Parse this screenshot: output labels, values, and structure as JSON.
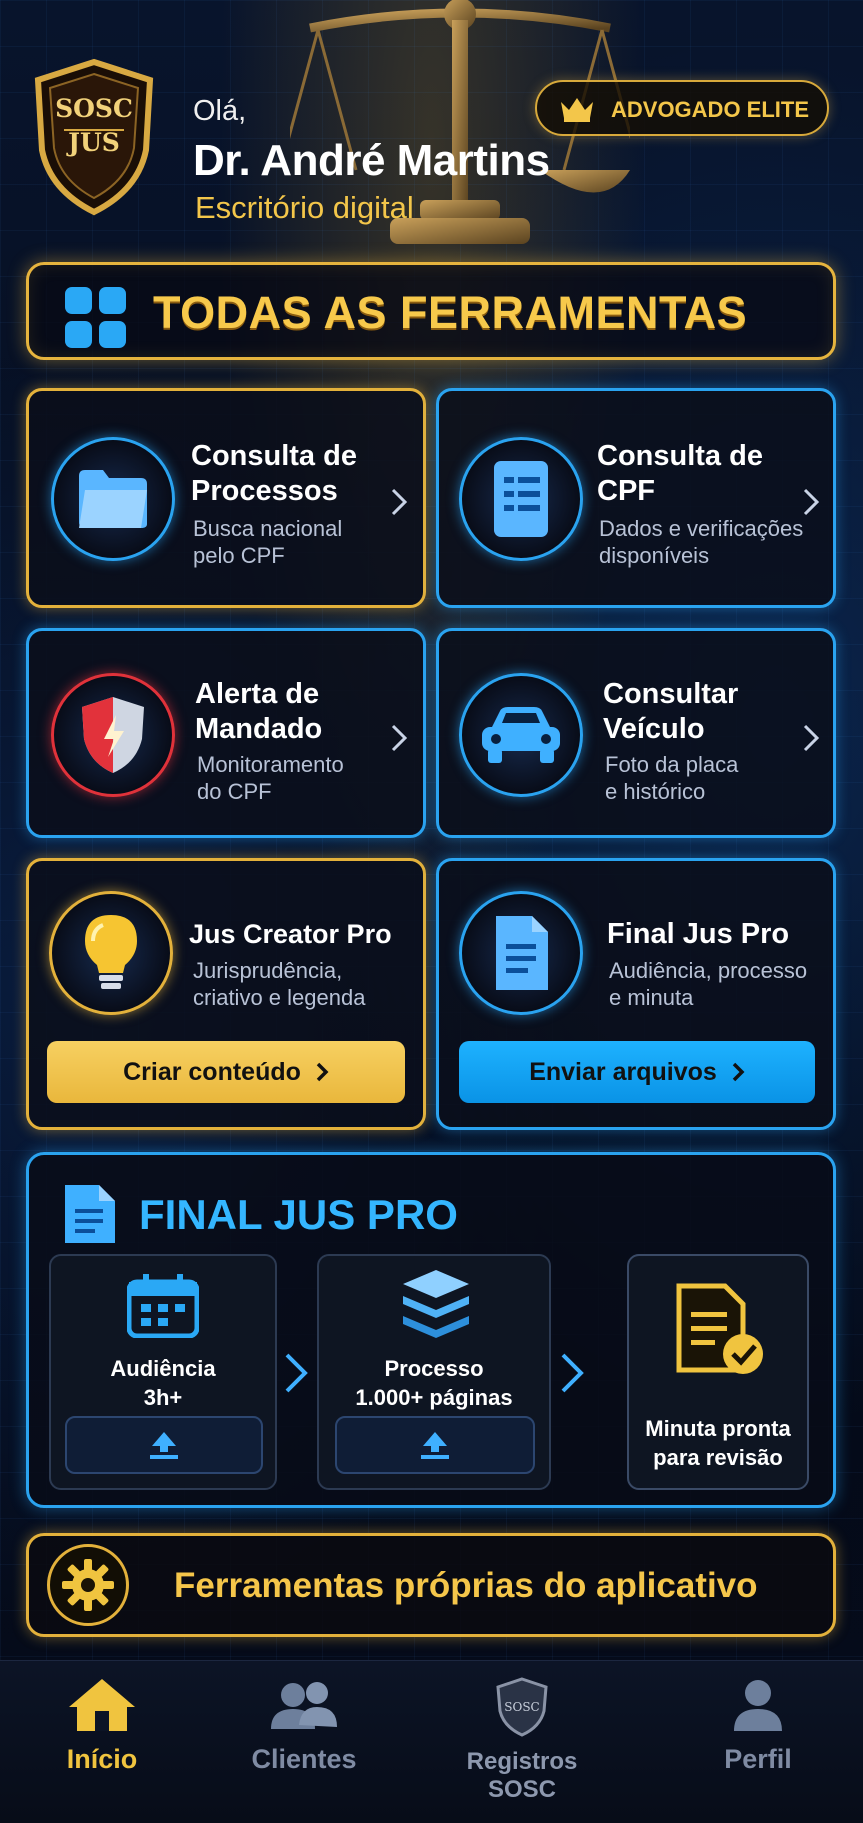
{
  "header": {
    "logo_line1": "SOSC",
    "logo_line2": "JUS",
    "greeting": "Olá,",
    "user_name": "Dr. André Martins",
    "subtitle": "Escritório digital",
    "badge_label": "ADVOGADO ELITE"
  },
  "section_title": "TODAS AS FERRAMENTAS",
  "cards": [
    {
      "title_line1": "Consulta de",
      "title_line2": "Processos",
      "sub_line1": "Busca nacional",
      "sub_line2": "pelo CPF",
      "icon": "folder-icon"
    },
    {
      "title_line1": "Consulta de",
      "title_line2": "CPF",
      "sub_line1": "Dados e verificações",
      "sub_line2": "disponíveis",
      "icon": "document-list-icon"
    },
    {
      "title_line1": "Alerta de",
      "title_line2": "Mandado",
      "sub_line1": "Monitoramento",
      "sub_line2": "do CPF",
      "icon": "shield-icon"
    },
    {
      "title_line1": "Consultar",
      "title_line2": "Veículo",
      "sub_line1": "Foto da placa",
      "sub_line2": "e histórico",
      "icon": "car-icon"
    },
    {
      "title_line1": "Jus Creator Pro",
      "sub_line1": "Jurisprudência,",
      "sub_line2": "criativo e legenda",
      "button": "Criar conteúdo",
      "icon": "lightbulb-icon"
    },
    {
      "title_line1": "Final Jus Pro",
      "sub_line1": "Audiência, processo",
      "sub_line2": "e minuta",
      "button": "Enviar arquivos",
      "icon": "document-icon"
    }
  ],
  "final_panel": {
    "title": "FINAL JUS PRO",
    "steps": [
      {
        "line1": "Audiência",
        "line2": "3h+"
      },
      {
        "line1": "Processo",
        "line2": "1.000+ páginas"
      },
      {
        "line1": "Minuta pronta",
        "line2": "para revisão"
      }
    ]
  },
  "tools_banner": "Ferramentas próprias do aplicativo",
  "nav": {
    "items": [
      {
        "label": "Início",
        "active": true
      },
      {
        "label": "Clientes",
        "active": false
      },
      {
        "label": "Registros SOSC",
        "active": false
      },
      {
        "label": "Perfil",
        "active": false
      }
    ],
    "sosc_badge": "SOSC"
  },
  "colors": {
    "gold": "#e3b13b",
    "blue": "#2aa3f0",
    "background": "#050b1a"
  }
}
